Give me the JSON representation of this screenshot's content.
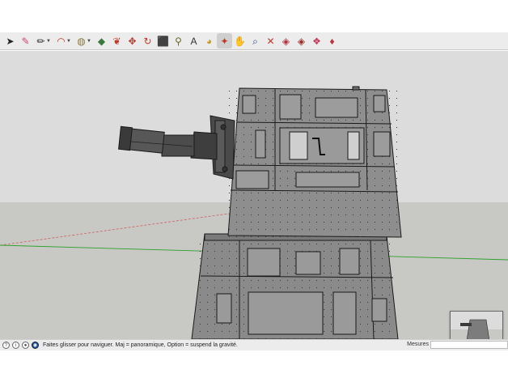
{
  "toolbar": {
    "tools": [
      {
        "name": "select-tool-icon",
        "glyph": "➤",
        "active": false,
        "caret": false,
        "color": "#222222"
      },
      {
        "name": "eraser-tool-icon",
        "glyph": "✎",
        "active": false,
        "caret": false,
        "color": "#d0457a"
      },
      {
        "name": "pencil-line-tool-icon",
        "glyph": "✏",
        "active": false,
        "caret": true,
        "color": "#2a2a2a"
      },
      {
        "name": "arc-tool-icon",
        "glyph": "◠",
        "active": false,
        "caret": true,
        "color": "#c0392b"
      },
      {
        "name": "shape-tool-icon",
        "glyph": "◍",
        "active": false,
        "caret": true,
        "color": "#8a7a3a"
      },
      {
        "name": "push-pull-tool-icon",
        "glyph": "◆",
        "active": false,
        "caret": false,
        "color": "#3a7a3a"
      },
      {
        "name": "follow-me-tool-icon",
        "glyph": "❦",
        "active": false,
        "caret": false,
        "color": "#c0392b"
      },
      {
        "name": "move-tool-icon",
        "glyph": "✥",
        "active": false,
        "caret": false,
        "color": "#c0392b"
      },
      {
        "name": "rotate-tool-icon",
        "glyph": "↻",
        "active": false,
        "caret": false,
        "color": "#c0392b"
      },
      {
        "name": "scale-tool-icon",
        "glyph": "⬛",
        "active": false,
        "caret": false,
        "color": "#c0392b"
      },
      {
        "name": "tape-measure-tool-icon",
        "glyph": "⚲",
        "active": false,
        "caret": false,
        "color": "#6a6a2a"
      },
      {
        "name": "text-tool-icon",
        "glyph": "A",
        "active": false,
        "caret": false,
        "color": "#333333"
      },
      {
        "name": "paint-bucket-tool-icon",
        "glyph": "◕",
        "active": false,
        "caret": false,
        "color": "#c89a2a"
      },
      {
        "name": "orbit-tool-icon",
        "glyph": "✦",
        "active": true,
        "caret": false,
        "color": "#c0392b"
      },
      {
        "name": "pan-tool-icon",
        "glyph": "✋",
        "active": false,
        "caret": false,
        "color": "#b08a5a"
      },
      {
        "name": "zoom-tool-icon",
        "glyph": "⌕",
        "active": false,
        "caret": false,
        "color": "#2a4a8a"
      },
      {
        "name": "zoom-extents-tool-icon",
        "glyph": "✕",
        "active": false,
        "caret": false,
        "color": "#c0392b"
      },
      {
        "name": "warehouse-icon",
        "glyph": "◈",
        "active": false,
        "caret": false,
        "color": "#b0303a"
      },
      {
        "name": "extension-warehouse-icon",
        "glyph": "◈",
        "active": false,
        "caret": false,
        "color": "#9a2a2a"
      },
      {
        "name": "components-icon",
        "glyph": "❖",
        "active": false,
        "caret": false,
        "color": "#c03a5a"
      },
      {
        "name": "extension-manager-icon",
        "glyph": "♦",
        "active": false,
        "caret": false,
        "color": "#c0303a"
      }
    ]
  },
  "viewport": {
    "sky_color": "#dcdcdc",
    "ground_color": "#c8c8c4",
    "model_face_color": "#8c8c8c",
    "model_edge_color": "#1a1a1a",
    "green_axis_color": "#2ea02e",
    "red_axis_color": "#d06060"
  },
  "status": {
    "icons": [
      "info-icon",
      "credits-icon",
      "user-icon",
      "geolocation-icon"
    ],
    "message": "Faites glisser pour naviguer. Maj = panoramique, Option =  suspend la gravité.",
    "measures_label": "Mesures",
    "measures_value": ""
  }
}
